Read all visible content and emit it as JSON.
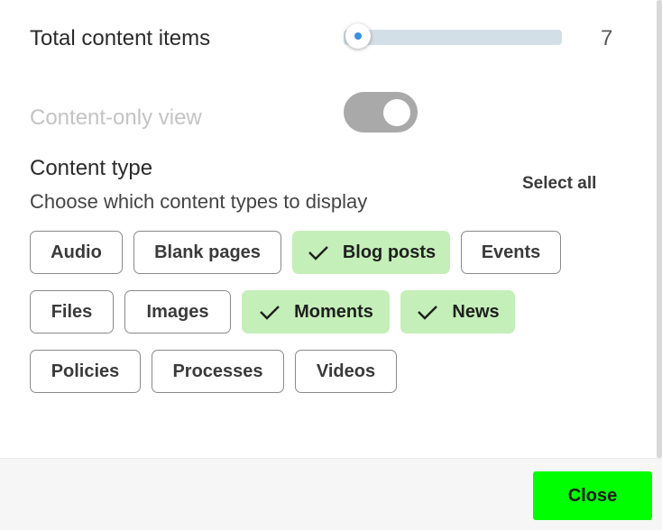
{
  "total_items": {
    "label": "Total content items",
    "value": "7",
    "slider_fraction": 0.0
  },
  "content_only": {
    "label": "Content-only view",
    "enabled": true
  },
  "content_type": {
    "title": "Content type",
    "description": "Choose which content types to display",
    "select_all_label": "Select all",
    "chips": [
      {
        "label": "Audio",
        "selected": false
      },
      {
        "label": "Blank pages",
        "selected": false
      },
      {
        "label": "Blog posts",
        "selected": true
      },
      {
        "label": "Events",
        "selected": false
      },
      {
        "label": "Files",
        "selected": false
      },
      {
        "label": "Images",
        "selected": false
      },
      {
        "label": "Moments",
        "selected": true
      },
      {
        "label": "News",
        "selected": true
      },
      {
        "label": "Policies",
        "selected": false
      },
      {
        "label": "Processes",
        "selected": false
      },
      {
        "label": "Videos",
        "selected": false
      }
    ]
  },
  "footer": {
    "close_label": "Close"
  },
  "colors": {
    "selected_chip": "#c4efb8",
    "close_button": "#00ff00",
    "slider_track": "#d3dfe7",
    "toggle_track": "#a9a9a9"
  }
}
